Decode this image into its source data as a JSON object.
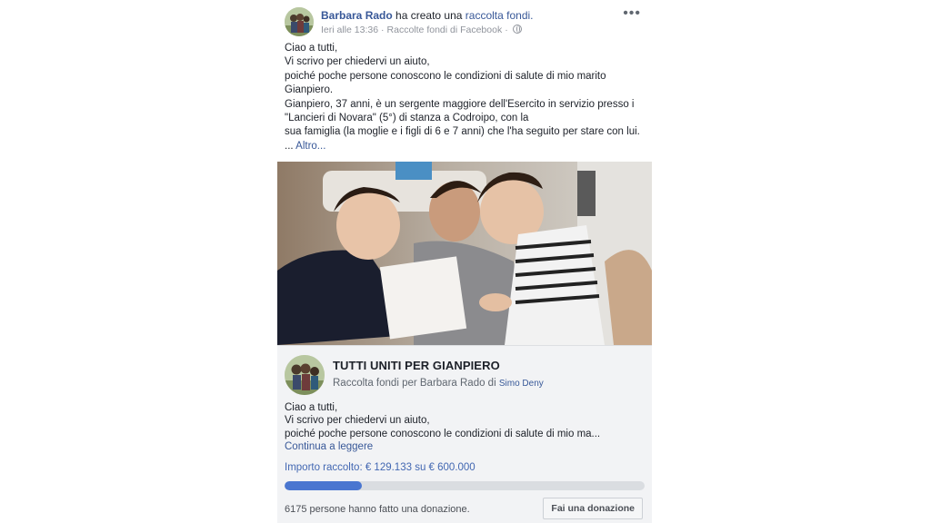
{
  "post": {
    "author": "Barbara Rado",
    "action_text": "ha creato una",
    "action_link": "raccolta fondi.",
    "timestamp": "Ieri alle 13:36",
    "separator": "·",
    "source": "Raccolte fondi di Facebook",
    "audience_icon": "globe-icon",
    "more_label": "•••",
    "body_lines": [
      "Ciao a tutti,",
      "Vi scrivo per chiedervi un aiuto,",
      "poiché poche persone conoscono le condizioni di salute di mio marito",
      "Gianpiero.",
      "Gianpiero, 37 anni, è un sergente maggiore dell'Esercito in servizio presso i",
      "\"Lancieri di Novara\" (5°) di stanza a Codroipo, con la",
      "sua famiglia (la moglie e i figli di 6 e 7 anni) che l'ha seguito per stare con lui."
    ],
    "ellipsis": "...",
    "see_more": "Altro..."
  },
  "fundraiser": {
    "title": "TUTTI UNITI PER GIANPIERO",
    "subtitle_prefix": "Raccolta fondi per Barbara Rado di",
    "organizer": "Simo Deny",
    "preview_lines": [
      "Ciao a tutti,",
      "Vi scrivo per chiedervi un aiuto,",
      "poiché poche persone conoscono le condizioni di salute di mio ma..."
    ],
    "continue_label": "Continua a leggere",
    "raised_text": "Importo raccolto: € 129.133 su € 600.000",
    "progress_fraction": 0.215,
    "donors_text": "6175 persone hanno fatto una donazione.",
    "donate_label": "Fai una donazione"
  },
  "colors": {
    "link": "#385898",
    "accent": "#4267b2",
    "progress_fill": "#4a76d0",
    "card_bg": "#f2f3f5"
  }
}
